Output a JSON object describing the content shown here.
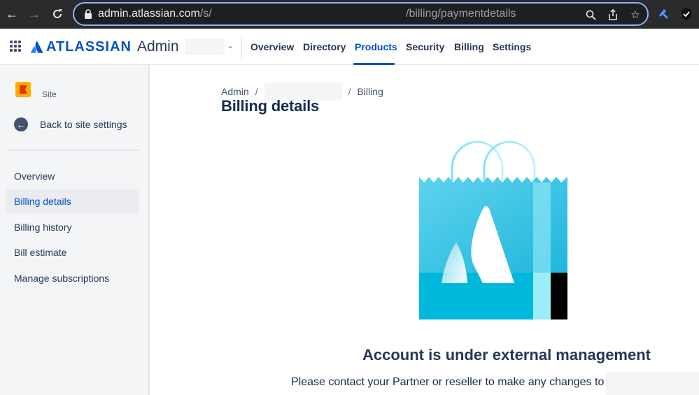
{
  "browser": {
    "url_host": "admin.atlassian.com",
    "url_path": "/s/",
    "url_tail": "/billing/paymentdetails",
    "icons": [
      "back-arrow-icon",
      "forward-arrow-icon",
      "reload-icon",
      "lock-icon",
      "zoom-icon",
      "share-icon",
      "star-icon",
      "extension-icon",
      "shield-icon"
    ]
  },
  "header": {
    "brand": "ATLASSIAN",
    "product": "Admin",
    "nav": [
      {
        "label": "Overview"
      },
      {
        "label": "Directory"
      },
      {
        "label": "Products"
      },
      {
        "label": "Security"
      },
      {
        "label": "Billing"
      },
      {
        "label": "Settings"
      }
    ],
    "active_nav": "Products"
  },
  "sidebar": {
    "site_label": "Site",
    "back_label": "Back to site settings",
    "items": [
      {
        "label": "Overview"
      },
      {
        "label": "Billing details"
      },
      {
        "label": "Billing history"
      },
      {
        "label": "Bill estimate"
      },
      {
        "label": "Manage subscriptions"
      }
    ],
    "selected_item": "Billing details"
  },
  "main": {
    "breadcrumb": {
      "root": "Admin",
      "sep": "/",
      "last": "Billing"
    },
    "title": "Billing details",
    "message_title": "Account is under external management",
    "message_body": "Please contact your Partner or reseller to make any changes to your"
  },
  "colors": {
    "brand_blue": "#0052cc",
    "text_dark": "#172b4d",
    "sidebar_bg": "#f4f5f7",
    "bag_cyan": "#00b8d9"
  }
}
